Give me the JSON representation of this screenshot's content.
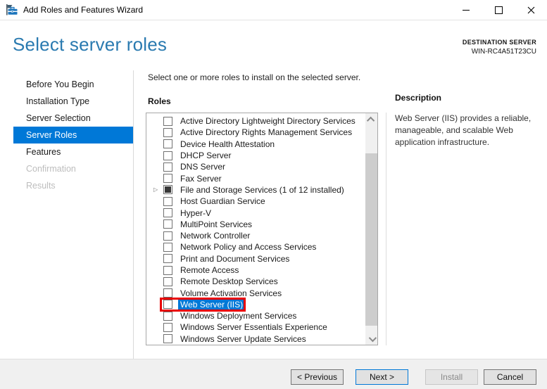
{
  "window": {
    "title": "Add Roles and Features Wizard"
  },
  "header": {
    "title": "Select server roles",
    "destination_label": "DESTINATION SERVER",
    "destination_server": "WIN-RC4A51T23CU"
  },
  "sidebar": {
    "items": [
      {
        "label": "Before You Begin",
        "state": "enabled"
      },
      {
        "label": "Installation Type",
        "state": "enabled"
      },
      {
        "label": "Server Selection",
        "state": "enabled"
      },
      {
        "label": "Server Roles",
        "state": "selected"
      },
      {
        "label": "Features",
        "state": "enabled"
      },
      {
        "label": "Confirmation",
        "state": "disabled"
      },
      {
        "label": "Results",
        "state": "disabled"
      }
    ]
  },
  "main": {
    "instruction": "Select one or more roles to install on the selected server.",
    "roles_label": "Roles",
    "roles": [
      {
        "label": "Active Directory Lightweight Directory Services",
        "checked": "unchecked",
        "expandable": false,
        "selected": false,
        "annotated": false
      },
      {
        "label": "Active Directory Rights Management Services",
        "checked": "unchecked",
        "expandable": false,
        "selected": false,
        "annotated": false
      },
      {
        "label": "Device Health Attestation",
        "checked": "unchecked",
        "expandable": false,
        "selected": false,
        "annotated": false
      },
      {
        "label": "DHCP Server",
        "checked": "unchecked",
        "expandable": false,
        "selected": false,
        "annotated": false
      },
      {
        "label": "DNS Server",
        "checked": "unchecked",
        "expandable": false,
        "selected": false,
        "annotated": false
      },
      {
        "label": "Fax Server",
        "checked": "unchecked",
        "expandable": false,
        "selected": false,
        "annotated": false
      },
      {
        "label": "File and Storage Services (1 of 12 installed)",
        "checked": "partial",
        "expandable": true,
        "selected": false,
        "annotated": false
      },
      {
        "label": "Host Guardian Service",
        "checked": "unchecked",
        "expandable": false,
        "selected": false,
        "annotated": false
      },
      {
        "label": "Hyper-V",
        "checked": "unchecked",
        "expandable": false,
        "selected": false,
        "annotated": false
      },
      {
        "label": "MultiPoint Services",
        "checked": "unchecked",
        "expandable": false,
        "selected": false,
        "annotated": false
      },
      {
        "label": "Network Controller",
        "checked": "unchecked",
        "expandable": false,
        "selected": false,
        "annotated": false
      },
      {
        "label": "Network Policy and Access Services",
        "checked": "unchecked",
        "expandable": false,
        "selected": false,
        "annotated": false
      },
      {
        "label": "Print and Document Services",
        "checked": "unchecked",
        "expandable": false,
        "selected": false,
        "annotated": false
      },
      {
        "label": "Remote Access",
        "checked": "unchecked",
        "expandable": false,
        "selected": false,
        "annotated": false
      },
      {
        "label": "Remote Desktop Services",
        "checked": "unchecked",
        "expandable": false,
        "selected": false,
        "annotated": false
      },
      {
        "label": "Volume Activation Services",
        "checked": "unchecked",
        "expandable": false,
        "selected": false,
        "annotated": false
      },
      {
        "label": "Web Server (IIS)",
        "checked": "unchecked",
        "expandable": false,
        "selected": true,
        "annotated": true
      },
      {
        "label": "Windows Deployment Services",
        "checked": "unchecked",
        "expandable": false,
        "selected": false,
        "annotated": false
      },
      {
        "label": "Windows Server Essentials Experience",
        "checked": "unchecked",
        "expandable": false,
        "selected": false,
        "annotated": false
      },
      {
        "label": "Windows Server Update Services",
        "checked": "unchecked",
        "expandable": false,
        "selected": false,
        "annotated": false
      }
    ]
  },
  "description": {
    "title": "Description",
    "text": "Web Server (IIS) provides a reliable, manageable, and scalable Web application infrastructure."
  },
  "footer": {
    "buttons": [
      {
        "label": "< Previous",
        "state": "normal"
      },
      {
        "label": "Next >",
        "state": "default"
      },
      {
        "label": "Install",
        "state": "disabled"
      },
      {
        "label": "Cancel",
        "state": "normal"
      }
    ]
  },
  "colors": {
    "accent": "#0078d7",
    "header_blue": "#2a7ab0",
    "annotation_red": "#e80000"
  }
}
